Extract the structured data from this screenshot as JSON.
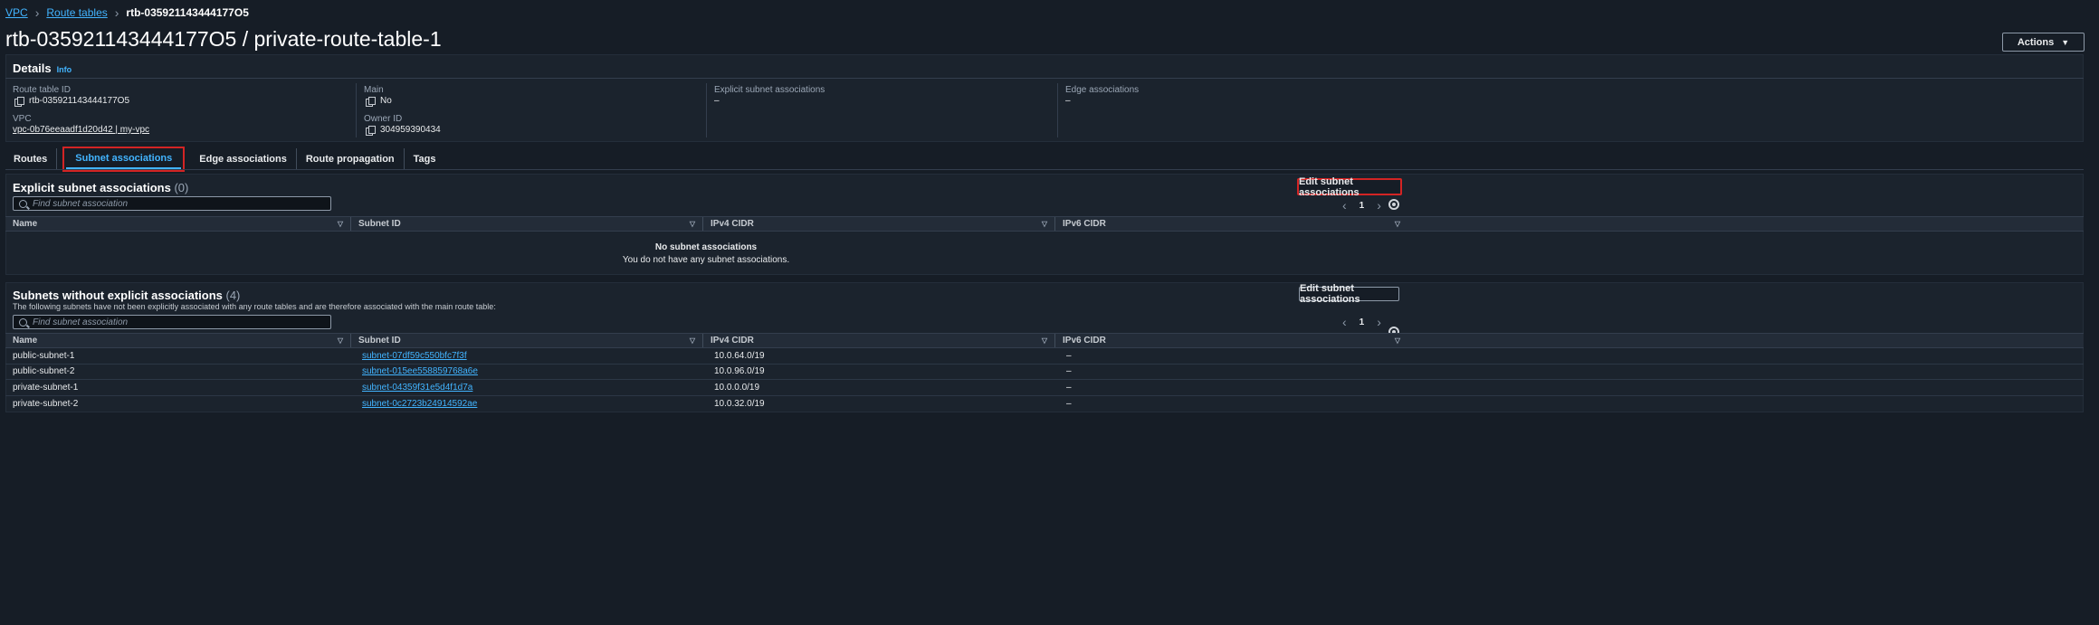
{
  "breadcrumb": {
    "root": "VPC",
    "parent": "Route tables",
    "current": "rtb-035921143444177O5"
  },
  "page_title": "rtb-035921143444177O5 / private-route-table-1",
  "actions_label": "Actions",
  "details": {
    "header": "Details",
    "info": "Info",
    "route_table_id_label": "Route table ID",
    "route_table_id": "rtb-035921143444177O5",
    "vpc_label": "VPC",
    "vpc_value": "vpc-0b76eeaadf1d20d42 | my-vpc",
    "main_label": "Main",
    "main_value": "No",
    "owner_label": "Owner ID",
    "owner_value": "304959390434",
    "explicit_label": "Explicit subnet associations",
    "explicit_value": "–",
    "edge_label": "Edge associations",
    "edge_value": "–"
  },
  "tabs": [
    "Routes",
    "Subnet associations",
    "Edge associations",
    "Route propagation",
    "Tags"
  ],
  "explicit_section": {
    "title": "Explicit subnet associations",
    "count": "(0)",
    "edit_label": "Edit subnet associations",
    "search_placeholder": "Find subnet association",
    "page": "1",
    "empty_title": "No subnet associations",
    "empty_sub": "You do not have any subnet associations."
  },
  "without_section": {
    "title": "Subnets without explicit associations",
    "count": "(4)",
    "description": "The following subnets have not been explicitly associated with any route tables and are therefore associated with the main route table:",
    "edit_label": "Edit subnet associations",
    "search_placeholder": "Find subnet association",
    "page": "1"
  },
  "columns": [
    "Name",
    "Subnet ID",
    "IPv4 CIDR",
    "IPv6 CIDR"
  ],
  "rows": [
    {
      "name": "public-subnet-1",
      "subnet_id": "subnet-07df59c550bfc7f3f",
      "ipv4": "10.0.64.0/19",
      "ipv6": "–"
    },
    {
      "name": "public-subnet-2",
      "subnet_id": "subnet-015ee558859768a6e",
      "ipv4": "10.0.96.0/19",
      "ipv6": "–"
    },
    {
      "name": "private-subnet-1",
      "subnet_id": "subnet-04359f31e5d4f1d7a",
      "ipv4": "10.0.0.0/19",
      "ipv6": "–"
    },
    {
      "name": "private-subnet-2",
      "subnet_id": "subnet-0c2723b24914592ae",
      "ipv4": "10.0.32.0/19",
      "ipv6": "–"
    }
  ],
  "colors": {
    "accent": "#42b4ff",
    "highlight": "#d32424",
    "background": "#161d26"
  }
}
